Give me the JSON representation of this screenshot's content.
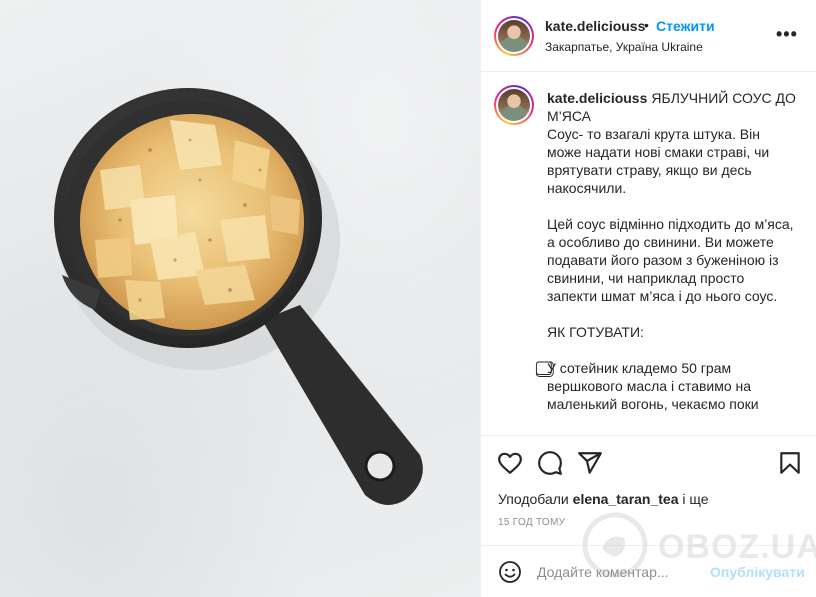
{
  "post": {
    "username": "kate.deliciouss",
    "follow_dot": "•",
    "follow_label": "Стежити",
    "location": "Закарпатье, Україна Ukraine",
    "more_label": "•••"
  },
  "caption": {
    "username": "kate.deliciouss",
    "text": "ЯБЛУЧНИЙ СОУС ДО М’ЯСА\nСоус- то взагалі крута штука. Він може надати нові смаки страві, чи врятувати страву, якщо ви десь накосячили.\n\nЦей соус відмінно підходить до м’яса, а особливо до свинини. Ви можете подавати його разом з буженіною із свинини, чи наприклад просто запекти шмат м’яса і до нього соус.\n\nЯК ГОТУВАТИ:\n\n⃣У сотейник кладемо 50 грам вершкового масла і ставимо на маленький вогонь, чекаємо поки"
  },
  "actions": {
    "icons": [
      "heart-icon",
      "comment-icon",
      "share-icon",
      "bookmark-icon"
    ],
    "likes_prefix": "Уподобали",
    "likes_user": "elena_taran_tea",
    "likes_suffix": "і ще",
    "time": "15 ГОД ТОМУ"
  },
  "comment": {
    "placeholder": "Додайте коментар...",
    "post_label": "Опублікувати"
  },
  "watermark": {
    "text": "OBOZ.UA"
  },
  "colors": {
    "link_blue": "#0095f6",
    "post_disabled": "#b2dffc",
    "muted": "#8e8e8e",
    "border": "#efefef"
  }
}
